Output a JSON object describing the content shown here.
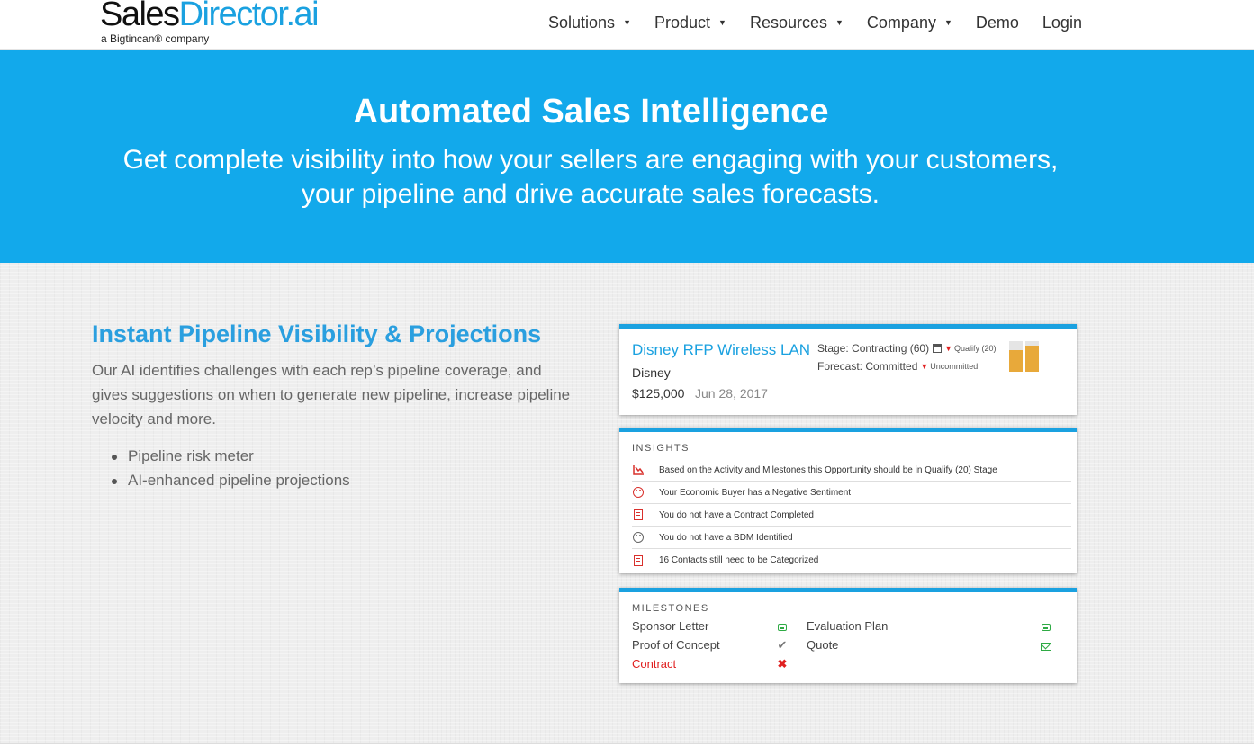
{
  "header": {
    "logo": {
      "part1": "Sales",
      "part2": "Director.ai",
      "tagline": "a Bigtincan® company"
    },
    "nav": [
      {
        "label": "Solutions",
        "dropdown": true
      },
      {
        "label": "Product",
        "dropdown": true
      },
      {
        "label": "Resources",
        "dropdown": true
      },
      {
        "label": "Company",
        "dropdown": true
      },
      {
        "label": "Demo",
        "dropdown": false
      },
      {
        "label": "Login",
        "dropdown": false
      }
    ]
  },
  "hero": {
    "title": "Automated Sales Intelligence",
    "subtitle_line1": "Get complete visibility into how your sellers are engaging with your customers,",
    "subtitle_line2": "your pipeline and drive accurate sales forecasts."
  },
  "section": {
    "title": "Instant Pipeline Visibility & Projections",
    "description": "Our AI identifies challenges with each rep’s pipeline coverage, and gives suggestions on when to generate new pipeline, increase pipeline velocity and more.",
    "bullets": [
      "Pipeline risk meter",
      "AI-enhanced pipeline projections"
    ]
  },
  "opportunity": {
    "title": "Disney RFP Wireless LAN",
    "company": "Disney",
    "amount": "$125,000",
    "date": "Jun 28, 2017",
    "stage_label": "Stage: Contracting (60)",
    "stage_suggest": "Qualify (20)",
    "forecast_label": "Forecast: Committed",
    "forecast_suggest": "Uncommitted",
    "risk_meter": {
      "bar1_level": 0.7,
      "bar2_level": 0.85,
      "color": "#e8a93a"
    }
  },
  "insights": {
    "heading": "INSIGHTS",
    "items": [
      {
        "icon": "trend-down-icon",
        "text": "Based on the Activity and Milestones this Opportunity should be in Qualify (20) Stage"
      },
      {
        "icon": "sad-face-icon",
        "text": "Your Economic Buyer has a Negative Sentiment"
      },
      {
        "icon": "edit-document-icon",
        "text": "You do not have a Contract Completed"
      },
      {
        "icon": "neutral-face-icon",
        "text": "You do not have a BDM Identified"
      },
      {
        "icon": "contacts-document-icon",
        "text": "16 Contacts still need to be Categorized"
      }
    ]
  },
  "milestones": {
    "heading": "MILESTONES",
    "items": [
      {
        "label": "Sponsor Letter",
        "status_icon": "inbox-icon"
      },
      {
        "label": "Evaluation Plan",
        "status_icon": "inbox-icon"
      },
      {
        "label": "Proof of Concept",
        "status_icon": "check-icon"
      },
      {
        "label": "Quote",
        "status_icon": "envelope-icon"
      },
      {
        "label": "Contract",
        "status_icon": "x-icon"
      }
    ]
  },
  "colors": {
    "brand_blue": "#12a9eb",
    "accent_blue": "#1aa1e0",
    "risk_orange": "#e8a93a",
    "danger_red": "#e02020",
    "success_green": "#2eaa44"
  }
}
